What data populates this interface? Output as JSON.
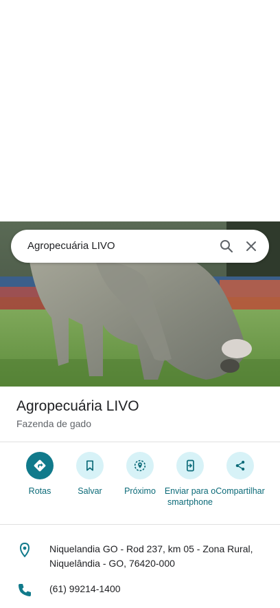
{
  "search": {
    "query": "Agropecuária LIVO"
  },
  "place": {
    "name": "Agropecuária LIVO",
    "category": "Fazenda de gado"
  },
  "actions": [
    {
      "label": "Rotas",
      "icon": "directions-icon"
    },
    {
      "label": "Salvar",
      "icon": "bookmark-icon"
    },
    {
      "label": "Próximo",
      "icon": "nearby-icon"
    },
    {
      "label": "Enviar para o smartphone",
      "icon": "send-to-phone-icon"
    },
    {
      "label": "Compartilhar",
      "icon": "share-icon"
    }
  ],
  "details": {
    "address": "Niquelandia GO - Rod 237, km 05 - Zona Rural, Niquelândia - GO, 76420-000",
    "phone": "(61) 99214-1400"
  },
  "colors": {
    "accent": "#117a8b",
    "accent_light": "#d7f2f7",
    "accent_text": "#0b6a78"
  }
}
